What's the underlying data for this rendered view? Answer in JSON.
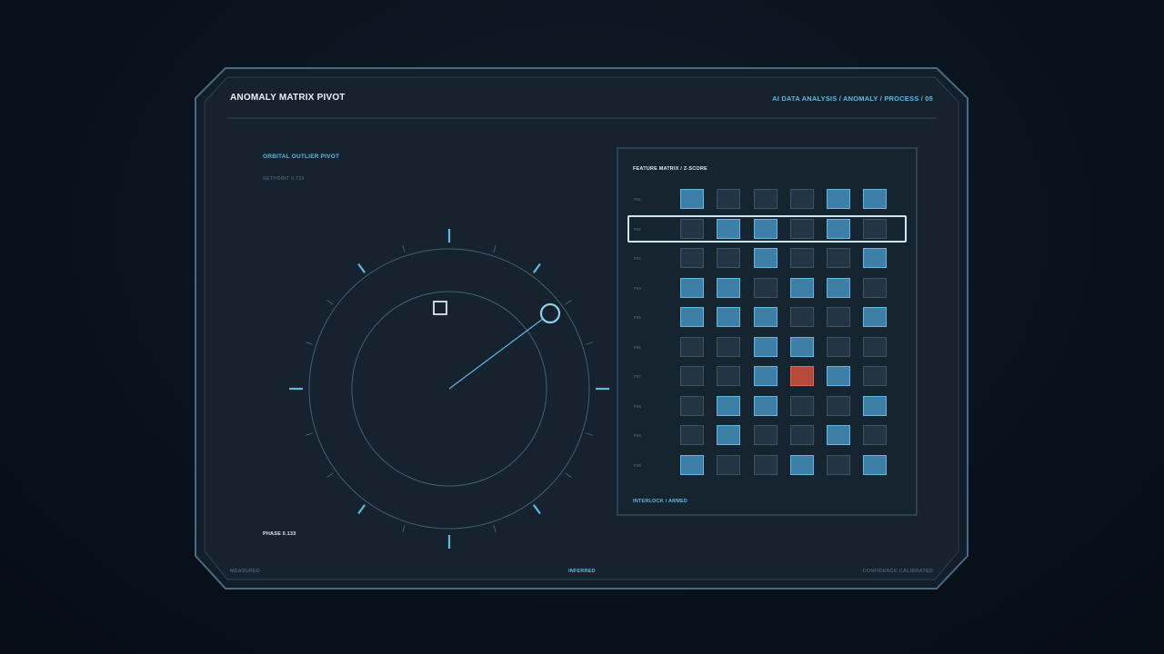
{
  "header": {
    "title": "ANOMALY MATRIX PIVOT",
    "breadcrumb": "AI DATA ANALYSIS / ANOMALY / PROCESS / 05"
  },
  "pivot": {
    "title": "ORBITAL OUTLIER PIVOT",
    "setpoint": "SETPOINT 0.739",
    "phase": "PHASE 0.133"
  },
  "matrix": {
    "title": "FEATURE MATRIX / Z-SCORE",
    "status": "INTERLOCK / ARMED",
    "selected_row": 1,
    "rows": [
      {
        "label": "F01",
        "cells": [
          "hi",
          "lo",
          "lo",
          "lo",
          "hi",
          "hi"
        ]
      },
      {
        "label": "F02",
        "cells": [
          "lo",
          "hi",
          "hi",
          "lo",
          "hi",
          "lo"
        ]
      },
      {
        "label": "F03",
        "cells": [
          "lo",
          "lo",
          "hi",
          "lo",
          "lo",
          "hi"
        ]
      },
      {
        "label": "F04",
        "cells": [
          "hi",
          "hi",
          "lo",
          "hi",
          "hi",
          "lo"
        ]
      },
      {
        "label": "F05",
        "cells": [
          "hi",
          "hi",
          "hi",
          "lo",
          "lo",
          "hi"
        ]
      },
      {
        "label": "F06",
        "cells": [
          "lo",
          "lo",
          "hi",
          "hi",
          "lo",
          "lo"
        ]
      },
      {
        "label": "F07",
        "cells": [
          "lo",
          "lo",
          "hi",
          "alert",
          "hi",
          "lo"
        ]
      },
      {
        "label": "F08",
        "cells": [
          "lo",
          "hi",
          "hi",
          "lo",
          "lo",
          "hi"
        ]
      },
      {
        "label": "F09",
        "cells": [
          "lo",
          "hi",
          "lo",
          "lo",
          "hi",
          "lo"
        ]
      },
      {
        "label": "F10",
        "cells": [
          "hi",
          "lo",
          "lo",
          "hi",
          "lo",
          "hi"
        ]
      }
    ]
  },
  "footer": {
    "left": "MEASURED",
    "center": "INFERRED",
    "right": "CONFIDENCE CALIBRATED"
  },
  "colors": {
    "accent": "#5fb8e6",
    "cell_high": "#3e7fa8",
    "cell_low": "#233444",
    "alert": "#b84a3c",
    "panel": "#16222e"
  }
}
